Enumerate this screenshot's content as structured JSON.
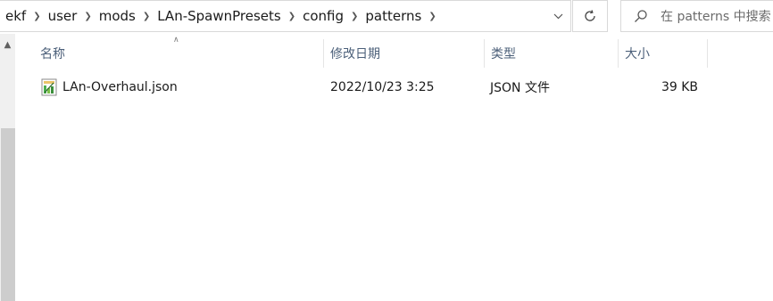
{
  "address": {
    "crumbs": [
      "ekf",
      "user",
      "mods",
      "LAn-SpawnPresets",
      "config",
      "patterns"
    ]
  },
  "search": {
    "placeholder": "在 patterns 中搜索"
  },
  "columns": {
    "name": "名称",
    "modified": "修改日期",
    "type": "类型",
    "size": "大小"
  },
  "files": [
    {
      "name": "LAn-Overhaul.json",
      "modified": "2022/10/23 3:25",
      "type": "JSON 文件",
      "size": "39 KB",
      "icon": "json-file-icon"
    }
  ]
}
